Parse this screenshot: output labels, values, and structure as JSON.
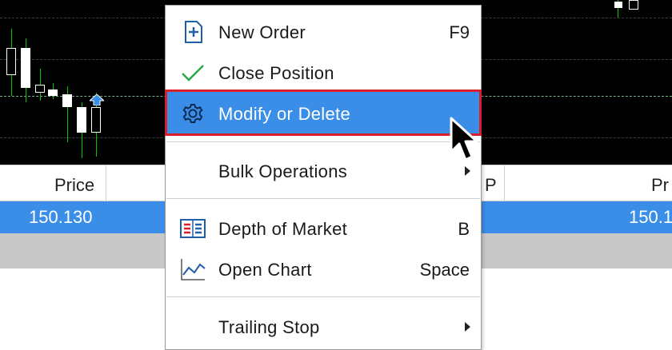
{
  "menu": {
    "items": [
      {
        "label": "New Order",
        "shortcut": "F9",
        "icon": "new-order-icon"
      },
      {
        "label": "Close Position",
        "shortcut": "",
        "icon": "checkmark-icon"
      },
      {
        "label": "Modify or Delete",
        "shortcut": "",
        "icon": "gear-icon",
        "highlighted": true
      },
      {
        "label": "Bulk Operations",
        "shortcut": "",
        "icon": "",
        "submenu": true
      },
      {
        "label": "Depth of Market",
        "shortcut": "B",
        "icon": "depth-of-market-icon"
      },
      {
        "label": "Open Chart",
        "shortcut": "Space",
        "icon": "chart-line-icon"
      },
      {
        "label": "Trailing Stop",
        "shortcut": "",
        "icon": "",
        "submenu": true
      }
    ]
  },
  "table": {
    "header_price_left": "Price",
    "header_p_mid": "P",
    "header_price_right": "Pr",
    "row_price_left": "150.130",
    "row_price_right": "150.1"
  },
  "colors": {
    "highlight": "#3b8ee8",
    "highlight_border": "#d8202a",
    "chart_bg": "#000000",
    "candle_wick": "#00c800"
  }
}
